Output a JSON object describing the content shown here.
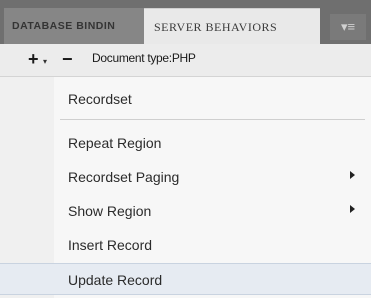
{
  "tabs": [
    {
      "label": "DATABASE BINDIN",
      "active": false
    },
    {
      "label": "SERVER BEHAVIORS",
      "active": true
    }
  ],
  "panel_menu_glyph": "▾≡",
  "toolbar": {
    "add_label": "+",
    "add_dropdown_glyph": "▾",
    "remove_label": "−",
    "document_type": "Document type:PHP"
  },
  "menu": {
    "items": [
      {
        "label": "Recordset",
        "submenu": false,
        "highlighted": false
      },
      {
        "label": "Repeat Region",
        "submenu": false,
        "highlighted": false
      },
      {
        "label": "Recordset Paging",
        "submenu": true,
        "highlighted": false
      },
      {
        "label": "Show Region",
        "submenu": true,
        "highlighted": false
      },
      {
        "label": "Insert Record",
        "submenu": false,
        "highlighted": false
      },
      {
        "label": "Update Record",
        "submenu": false,
        "highlighted": true
      }
    ]
  },
  "colors": {
    "tabbar_bg": "#6f6f6f",
    "active_tab_bg": "#e9e9e9",
    "menu_bg": "#f7f7f7",
    "highlight_bg": "#e6ebf2"
  }
}
